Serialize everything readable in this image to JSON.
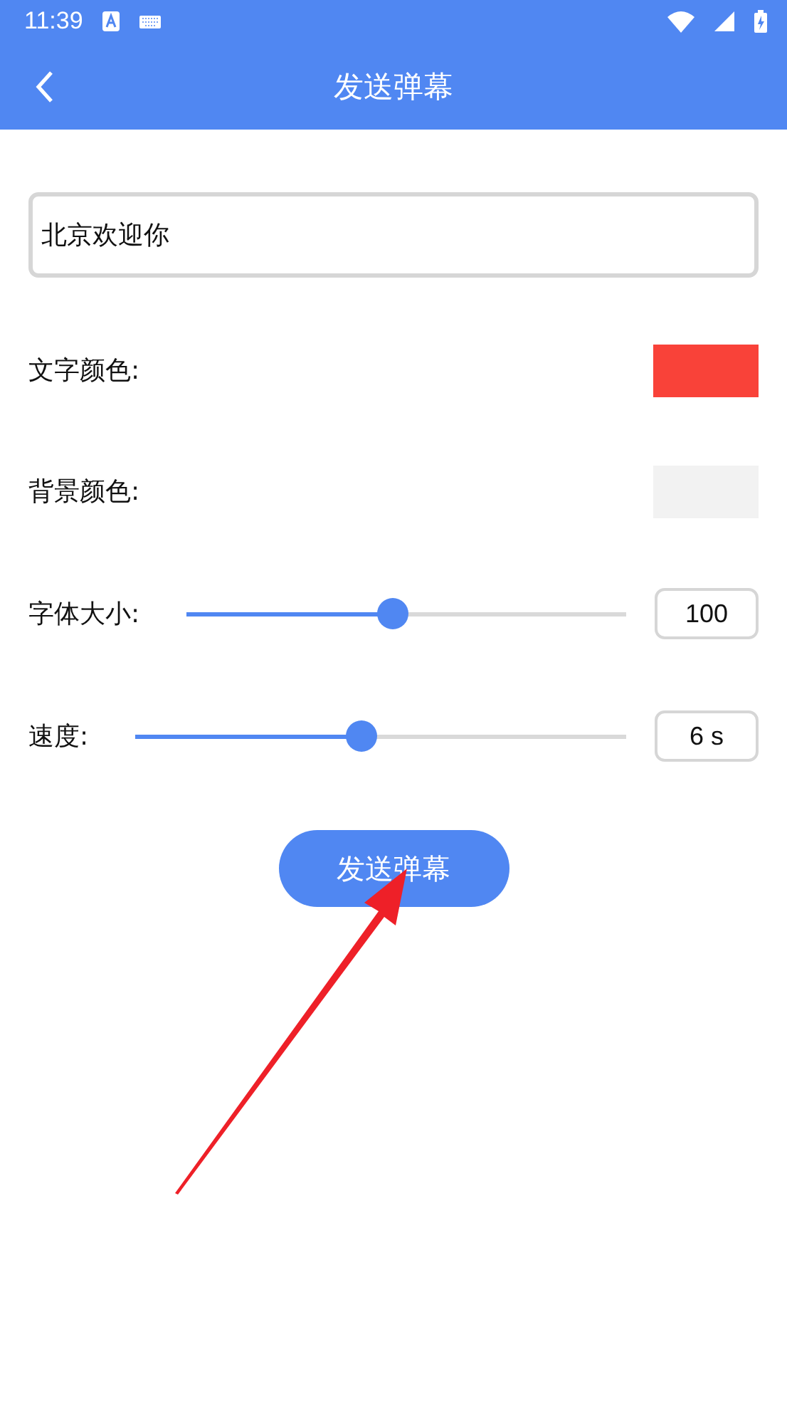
{
  "status_bar": {
    "time": "11:39"
  },
  "app_bar": {
    "title": "发送弹幕"
  },
  "message_field": {
    "value": "北京欢迎你"
  },
  "colors": [
    {
      "label": "文字颜色:",
      "color": "#f94239"
    },
    {
      "label": "背景颜色:",
      "color": "#f2f2f2"
    }
  ],
  "sliders": [
    {
      "label": "字体大小:",
      "level": 0.47,
      "reading": "100"
    },
    {
      "label": "速度:",
      "level": 0.46,
      "reading": "6 s"
    }
  ],
  "send_button": {
    "label": "发送弹幕"
  }
}
